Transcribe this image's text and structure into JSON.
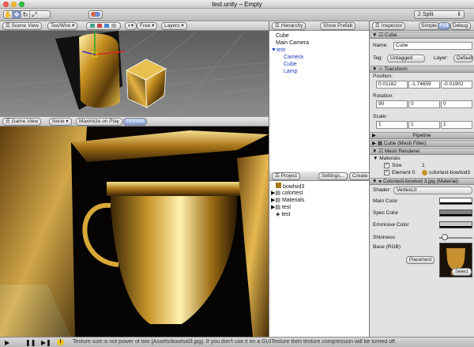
{
  "window": {
    "title": "test.unity – Empty"
  },
  "toolbar": {
    "tools": [
      "✋",
      "✥",
      "↻",
      "⤢"
    ],
    "layout_select": "2 Split"
  },
  "scene_view": {
    "label": "Scene View",
    "shading": "Tex/Wire",
    "free": "Free",
    "layers": "Layers"
  },
  "game_view": {
    "label": "Game View",
    "aspect": "None",
    "maximize": "Maximize on Play",
    "gizmos": "Gizmos"
  },
  "hierarchy": {
    "tab": "Hierarchy",
    "show_prefab": "Show Prefab",
    "items": [
      {
        "label": "Cube",
        "indent": 0,
        "selected": false,
        "arrow": false
      },
      {
        "label": "Main Camera",
        "indent": 0,
        "selected": false,
        "arrow": false
      },
      {
        "label": "test",
        "indent": 0,
        "selected": true,
        "arrow": true
      },
      {
        "label": "Camera",
        "indent": 1,
        "selected": true,
        "arrow": false
      },
      {
        "label": "Cube",
        "indent": 1,
        "selected": true,
        "arrow": false
      },
      {
        "label": "Lamp",
        "indent": 1,
        "selected": true,
        "arrow": false
      }
    ]
  },
  "project": {
    "tab": "Project",
    "settings": "Settings...",
    "create": "Create",
    "items": [
      {
        "label": "bowlsid3",
        "arrow": false
      },
      {
        "label": "colortest",
        "arrow": true
      },
      {
        "label": "Materials",
        "arrow": true
      },
      {
        "label": "test",
        "arrow": true
      },
      {
        "label": "test",
        "arrow": false
      }
    ]
  },
  "inspector": {
    "tab": "Inspector",
    "modes": [
      "Simple",
      "Full",
      "Debug"
    ],
    "object_name": "Cube",
    "name_label": "Name:",
    "name_value": "Cube",
    "tag_label": "Tag:",
    "tag_value": "Untagged",
    "layer_label": "Layer:",
    "layer_value": "Default",
    "transform": {
      "header": "Transform",
      "position_label": "Position:",
      "position": [
        "0.01182",
        "-1.74659",
        "-0.01902"
      ],
      "rotation_label": "Rotation:",
      "rotation": [
        "90",
        "0",
        "0"
      ],
      "scale_label": "Scale:",
      "scale": [
        "1",
        "1",
        "1"
      ]
    },
    "pipeline": "Pipeline",
    "mesh_filter": "Cube (Mesh Filter)",
    "mesh_renderer": "Mesh Renderer",
    "materials_label": "Materials",
    "size_label": "Size",
    "size_value": "1",
    "element_label": "Element 0",
    "element_value": "colortest-bowlsid3",
    "material_header": "Colortest-bowlsid 3.jpg (Material)",
    "shader_label": "Shader:",
    "shader_value": "VertexLit",
    "props": [
      {
        "label": "Main Color",
        "color": "#ffffff"
      },
      {
        "label": "Spec Color",
        "color": "#808080"
      },
      {
        "label": "Emmisive Color",
        "color": "#c8c8c8"
      }
    ],
    "shininess_label": "Shininess",
    "shininess_value": 0.1,
    "base_label": "Base (RGB)",
    "placement": "Placement",
    "select": "Select"
  },
  "status": {
    "message": "Texture size is not power of two [Assets/bowlsid3.jpg]. If you don't use it on a GUITexture then texture compression will be turned off."
  }
}
